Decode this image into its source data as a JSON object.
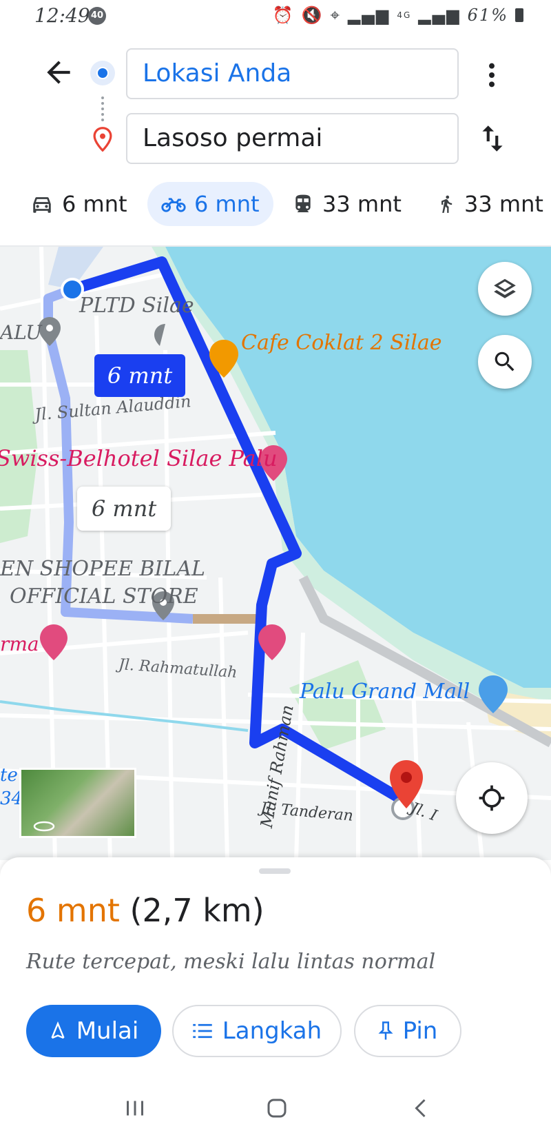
{
  "status_bar": {
    "time": "12:49",
    "badge": "40",
    "network": "4G",
    "battery": "61%"
  },
  "header": {
    "origin": "Lokasi Anda",
    "destination": "Lasoso permai"
  },
  "modes": [
    {
      "icon": "car-icon",
      "label": "6 mnt",
      "selected": false
    },
    {
      "icon": "motorbike-icon",
      "label": "6 mnt",
      "selected": true
    },
    {
      "icon": "transit-icon",
      "label": "33 mnt",
      "selected": false
    },
    {
      "icon": "walk-icon",
      "label": "33 mnt",
      "selected": false
    }
  ],
  "map": {
    "labels": {
      "pltd": "PLTD Silae",
      "cafe": "Cafe Coklat 2 Silae",
      "alu": "ALU",
      "sultan": "Jl. Sultan Alauddin",
      "hotel": "Swiss-Belhotel Silae Palu",
      "shopee1": "EN SHOPEE BILAL",
      "shopee2": "OFFICIAL STORE",
      "rma": "rma",
      "rahmatullah": "Jl. Rahmatullah",
      "mall": "Palu Grand Mall",
      "munif": "Munif Rahman",
      "tanderan": "Jl. Tanderan",
      "jl": "Jl. I",
      "te": "te",
      "n34": "34"
    },
    "route_bubble_primary": "6 mnt",
    "route_bubble_alt": "6 mnt"
  },
  "sheet": {
    "duration": "6 mnt",
    "distance": "(2,7 km)",
    "note": "Rute tercepat, meski lalu lintas normal",
    "buttons": {
      "start": "Mulai",
      "steps": "Langkah",
      "pin": "Pin"
    }
  },
  "colors": {
    "accent": "#1a73e8",
    "route": "#1a3ff0",
    "duration_orange": "#e37400",
    "water": "#8fd8ec",
    "dest_marker": "#ea4335"
  }
}
